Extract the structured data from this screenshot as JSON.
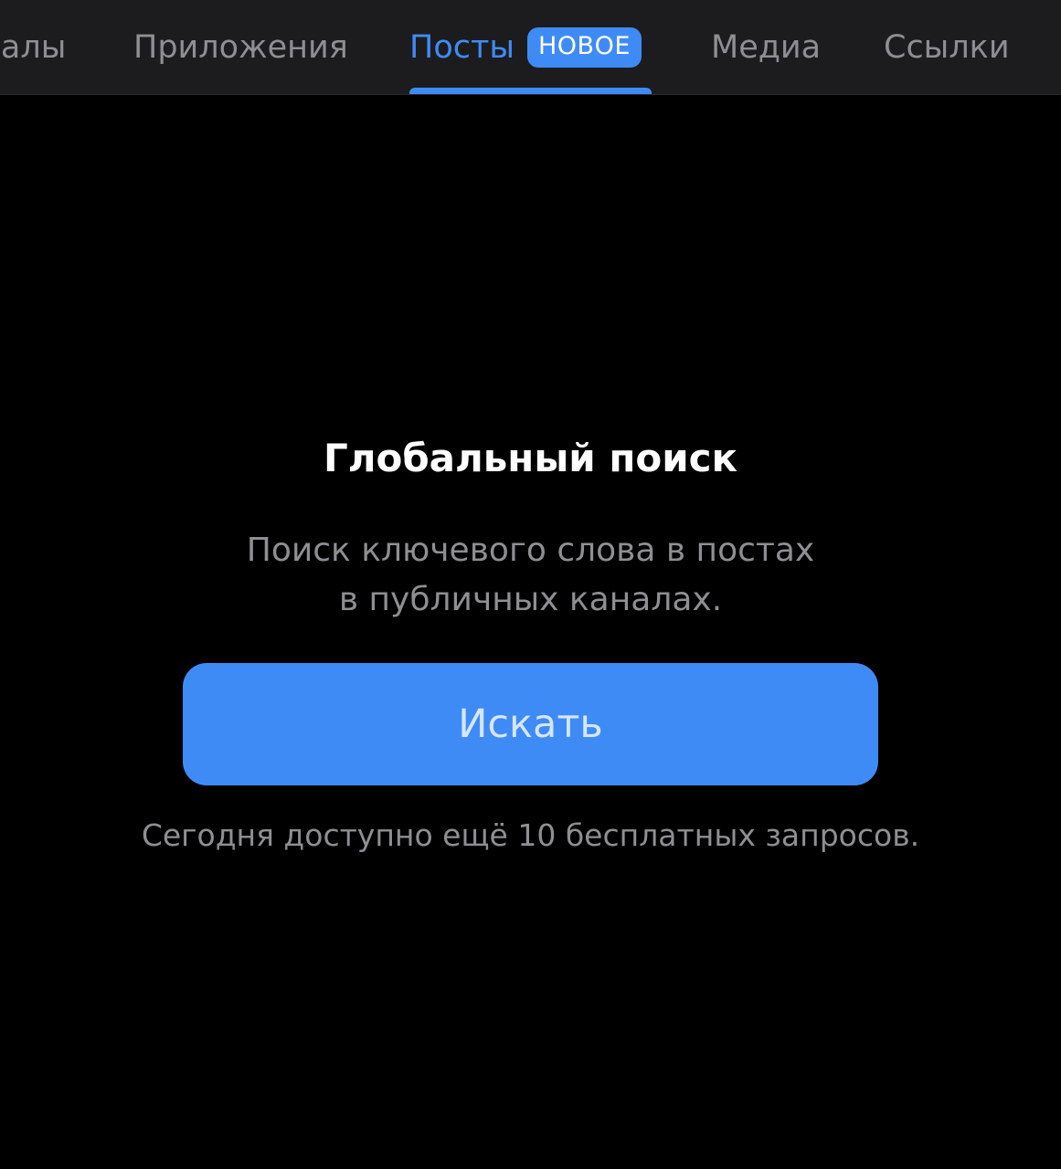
{
  "tabs": {
    "channels": "налы",
    "apps": "Приложения",
    "posts": "Посты",
    "posts_badge": "НОВОЕ",
    "media": "Медиа",
    "links": "Ссылки"
  },
  "empty_state": {
    "title": "Глобальный поиск",
    "description_line1": "Поиск ключевого слова в постах",
    "description_line2": "в публичных каналах.",
    "button_label": "Искать",
    "quota_text": "Сегодня доступно ещё 10 бесплатных запросов."
  },
  "colors": {
    "accent": "#3f8bf5",
    "tabbar_bg": "#1c1c1e",
    "background": "#000000",
    "secondary_text": "#8e8e93"
  }
}
